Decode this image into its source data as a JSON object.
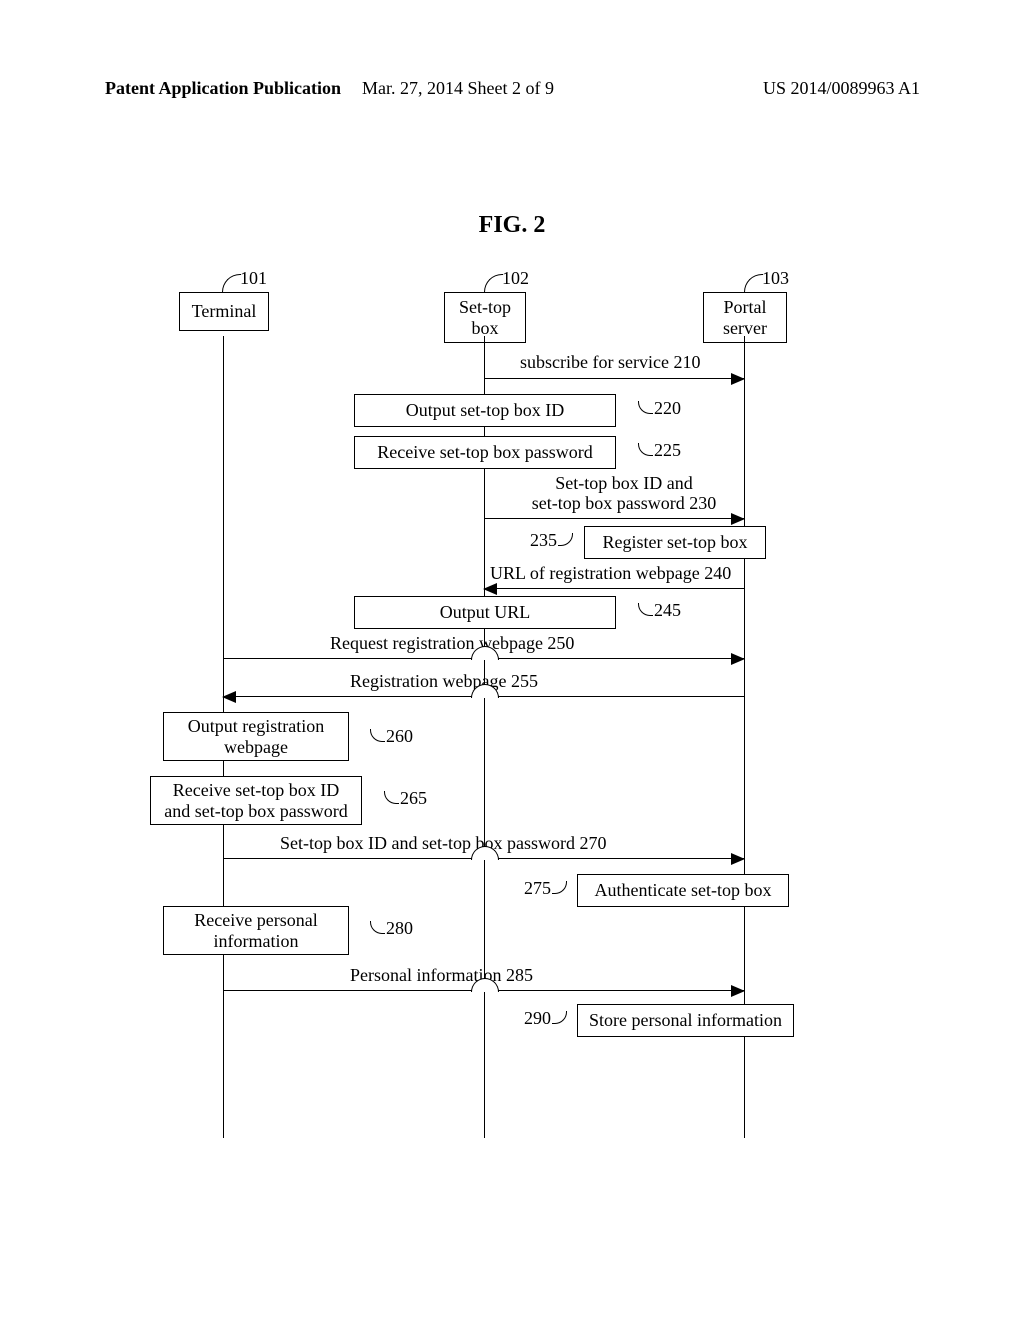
{
  "header": {
    "left": "Patent Application Publication",
    "center": "Mar. 27, 2014  Sheet 2 of 9",
    "right": "US 2014/0089963 A1"
  },
  "figure_title": "FIG. 2",
  "tags": {
    "a": "101",
    "b": "102",
    "c": "103"
  },
  "actors": {
    "a": "Terminal",
    "b": "Set-top\nbox",
    "c": "Portal\nserver"
  },
  "messages": {
    "m210": "subscribe for service 210",
    "m230a": "Set-top box ID and",
    "m230b": "set-top box password 230",
    "m240": "URL of registration webpage 240",
    "m250": "Request registration webpage 250",
    "m255": "Registration webpage 255",
    "m270": "Set-top box ID and set-top box password 270",
    "m285": "Personal information 285"
  },
  "steps": {
    "s220": "Output set-top box ID",
    "s225": "Receive set-top box password",
    "s235": "Register set-top box",
    "s245": "Output URL",
    "s260": "Output registration\nwebpage",
    "s265": "Receive set-top box ID\nand set-top box password",
    "s275": "Authenticate set-top box",
    "s280": "Receive personal\ninformation",
    "s290": "Store personal information"
  },
  "refs": {
    "r220": "220",
    "r225": "225",
    "r235": "235",
    "r245": "245",
    "r260": "260",
    "r265": "265",
    "r275": "275",
    "r280": "280",
    "r290": "290"
  },
  "chart_data": {
    "type": "sequence_diagram",
    "actors": [
      {
        "id": "101",
        "name": "Terminal"
      },
      {
        "id": "102",
        "name": "Set-top box"
      },
      {
        "id": "103",
        "name": "Portal server"
      }
    ],
    "steps": [
      {
        "ref": "210",
        "from": "102",
        "to": "103",
        "kind": "message",
        "label": "subscribe for service"
      },
      {
        "ref": "220",
        "at": "102",
        "kind": "process",
        "label": "Output set-top box ID"
      },
      {
        "ref": "225",
        "at": "102",
        "kind": "process",
        "label": "Receive set-top box password"
      },
      {
        "ref": "230",
        "from": "102",
        "to": "103",
        "kind": "message",
        "label": "Set-top box ID and set-top box password"
      },
      {
        "ref": "235",
        "at": "103",
        "kind": "process",
        "label": "Register set-top box"
      },
      {
        "ref": "240",
        "from": "103",
        "to": "102",
        "kind": "message",
        "label": "URL of registration webpage"
      },
      {
        "ref": "245",
        "at": "102",
        "kind": "process",
        "label": "Output URL"
      },
      {
        "ref": "250",
        "from": "101",
        "to": "103",
        "kind": "message",
        "over": "102",
        "label": "Request registration webpage"
      },
      {
        "ref": "255",
        "from": "103",
        "to": "101",
        "kind": "message",
        "over": "102",
        "label": "Registration webpage"
      },
      {
        "ref": "260",
        "at": "101",
        "kind": "process",
        "label": "Output registration webpage"
      },
      {
        "ref": "265",
        "at": "101",
        "kind": "process",
        "label": "Receive set-top box ID and set-top box password"
      },
      {
        "ref": "270",
        "from": "101",
        "to": "103",
        "kind": "message",
        "over": "102",
        "label": "Set-top box ID and set-top box password"
      },
      {
        "ref": "275",
        "at": "103",
        "kind": "process",
        "label": "Authenticate set-top box"
      },
      {
        "ref": "280",
        "at": "101",
        "kind": "process",
        "label": "Receive personal information"
      },
      {
        "ref": "285",
        "from": "101",
        "to": "103",
        "kind": "message",
        "over": "102",
        "label": "Personal information"
      },
      {
        "ref": "290",
        "at": "103",
        "kind": "process",
        "label": "Store personal information"
      }
    ]
  }
}
